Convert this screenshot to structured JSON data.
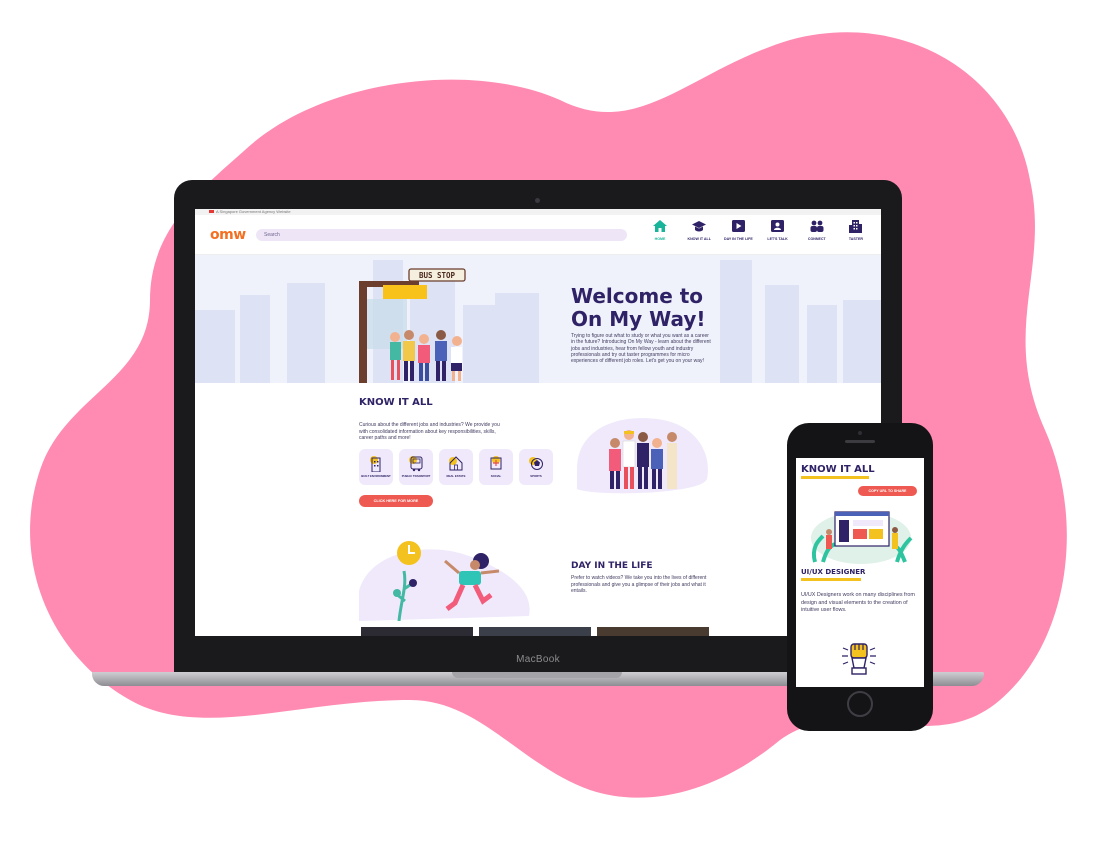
{
  "site": {
    "gov_banner": "A Singapore Government Agency Website",
    "logo": "omw",
    "search_placeholder": "Search",
    "nav": [
      {
        "label": "HOME",
        "icon": "home-icon",
        "active": true
      },
      {
        "label": "KNOW IT ALL",
        "icon": "graduation-cap-icon",
        "active": false
      },
      {
        "label": "DAY IN THE LIFE",
        "icon": "video-play-icon",
        "active": false
      },
      {
        "label": "LET'S TALK",
        "icon": "profile-card-icon",
        "active": false
      },
      {
        "label": "CONNECT",
        "icon": "people-icon",
        "active": false
      },
      {
        "label": "TASTER",
        "icon": "buildings-icon",
        "active": false
      }
    ],
    "hero": {
      "title_line1": "Welcome to",
      "title_line2": "On My Way!",
      "sign": "BUS STOP",
      "text": "Trying to figure out what to study or what you want as a career in the future? Introducing On My Way - learn about the different jobs and industries, hear from fellow youth and industry professionals and try out taster programmes for micro experiences of different job roles. Let's get you on your way!"
    },
    "know_it_all": {
      "title": "KNOW IT ALL",
      "text": "Curious about the different jobs and industries? We provide you with consolidated information about key responsibilities, skills, career paths and more!",
      "industries": [
        {
          "label": "BUILT ENVIRONMENT",
          "icon": "building-icon"
        },
        {
          "label": "PUBLIC TRANSPORT",
          "icon": "bus-icon"
        },
        {
          "label": "REAL ESTATE",
          "icon": "house-icon"
        },
        {
          "label": "SOCIAL",
          "icon": "social-icon"
        },
        {
          "label": "SPORTS",
          "icon": "sports-ball-icon"
        }
      ],
      "cta": "CLICK HERE FOR MORE"
    },
    "day_in_the_life": {
      "title": "DAY IN THE LIFE",
      "text": "Prefer to watch videos? We take you into the lives of different professionals and give you a glimpse of their jobs and what it entails."
    }
  },
  "device_label": "MacBook",
  "phone": {
    "title": "KNOW IT ALL",
    "copy_button": "COPY URL TO SHARE",
    "role": "UI/UX DESIGNER",
    "description": "UI/UX Designers work on many disciplines from design and visual elements to the creation of intuitive user flows."
  },
  "colors": {
    "brand_purple": "#2f2266",
    "accent_teal": "#18b59a",
    "cta_red": "#ee5a52",
    "highlight_yellow": "#f4c21e",
    "blob_pink": "#ff8ab2",
    "logo_orange": "#f36f21"
  }
}
